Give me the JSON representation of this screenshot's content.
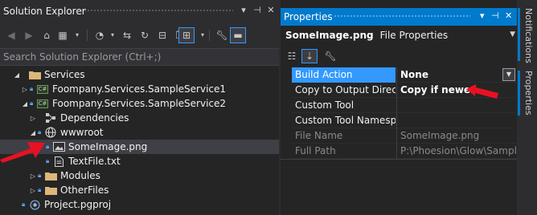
{
  "solution_explorer": {
    "title": "Solution Explorer",
    "search_placeholder": "Search Solution Explorer (Ctrl+;)",
    "tree": [
      {
        "label": "Services",
        "icon": "folder-icon",
        "expanded": true,
        "locked": false,
        "selected": false
      },
      {
        "label": "Foompany.Services.SampleService1",
        "icon": "csharp-project-icon",
        "expanded": false,
        "locked": true,
        "selected": false
      },
      {
        "label": "Foompany.Services.SampleService2",
        "icon": "csharp-project-icon",
        "expanded": true,
        "locked": true,
        "selected": false
      },
      {
        "label": "Dependencies",
        "icon": "dependencies-icon",
        "expanded": false,
        "locked": false,
        "selected": false
      },
      {
        "label": "wwwroot",
        "icon": "globe-icon",
        "expanded": true,
        "locked": true,
        "selected": false
      },
      {
        "label": "SomeImage.png",
        "icon": "image-file-icon",
        "expanded": null,
        "locked": true,
        "selected": true
      },
      {
        "label": "TextFile.txt",
        "icon": "text-file-icon",
        "expanded": null,
        "locked": true,
        "selected": false
      },
      {
        "label": "Modules",
        "icon": "folder-icon",
        "expanded": false,
        "locked": true,
        "selected": false
      },
      {
        "label": "OtherFiles",
        "icon": "folder-icon",
        "expanded": false,
        "locked": true,
        "selected": false
      },
      {
        "label": "Project.pgproj",
        "icon": "project-file-icon",
        "expanded": null,
        "locked": true,
        "selected": false
      }
    ]
  },
  "properties": {
    "title": "Properties",
    "object_name": "SomeImage.png",
    "object_kind": "File Properties",
    "rows": [
      {
        "key": "Build Action",
        "value": "None",
        "selected": true,
        "bold": true,
        "readonly": false,
        "dropdown": true
      },
      {
        "key": "Copy to Output Directo",
        "value": "Copy if newer",
        "selected": false,
        "bold": true,
        "readonly": false,
        "dropdown": false
      },
      {
        "key": "Custom Tool",
        "value": "",
        "selected": false,
        "bold": false,
        "readonly": false,
        "dropdown": false
      },
      {
        "key": "Custom Tool Namespac",
        "value": "",
        "selected": false,
        "bold": false,
        "readonly": false,
        "dropdown": false
      },
      {
        "key": "File Name",
        "value": "SomeImage.png",
        "selected": false,
        "bold": false,
        "readonly": true,
        "dropdown": false
      },
      {
        "key": "Full Path",
        "value": "P:\\Phoesion\\Glow\\Samples\\",
        "selected": false,
        "bold": false,
        "readonly": true,
        "dropdown": false
      }
    ]
  },
  "side_tabs": {
    "notifications": "Notifications",
    "properties": "Properties"
  },
  "colors": {
    "accent": "#007acc",
    "selection": "#3399ff",
    "annotation_arrow": "#e81123"
  }
}
